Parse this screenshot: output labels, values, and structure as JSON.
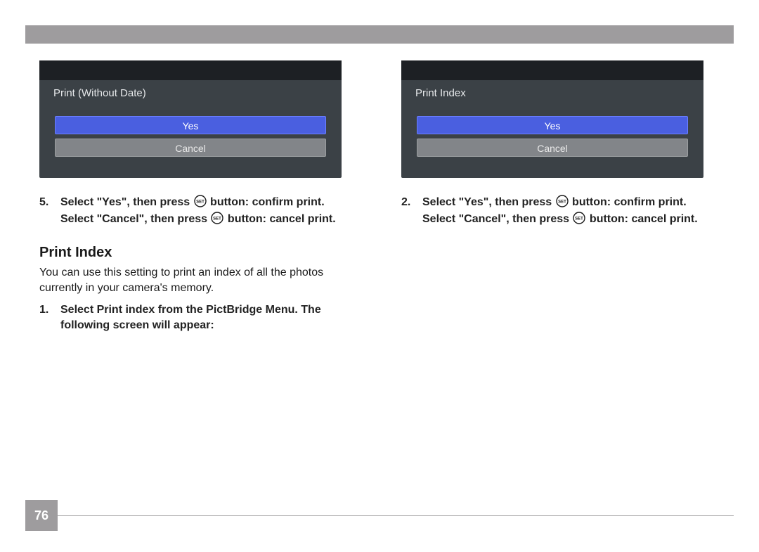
{
  "page_number": "76",
  "left": {
    "screenshot": {
      "title": "Print (Without Date)",
      "yes": "Yes",
      "cancel": "Cancel"
    },
    "step5_num": "5.",
    "step5_line1a": "Select \"Yes\", then press ",
    "step5_line1b": " button: confirm print.",
    "step5_line2a": "Select \"Cancel\", then press ",
    "step5_line2b": " button: cancel print.",
    "section_heading": "Print Index",
    "section_body": "You can use this setting to print an index of all the photos currently in your camera's memory.",
    "step1_num": "1.",
    "step1_text": "Select Print index from the PictBridge Menu. The following screen will appear:"
  },
  "right": {
    "screenshot": {
      "title": "Print Index",
      "yes": "Yes",
      "cancel": "Cancel"
    },
    "step2_num": "2.",
    "step2_line1a": "Select \"Yes\", then press ",
    "step2_line1b": " button: confirm print.",
    "step2_line2a": "Select \"Cancel\", then press ",
    "step2_line2b": " button: cancel print."
  },
  "icon_label": "SET"
}
